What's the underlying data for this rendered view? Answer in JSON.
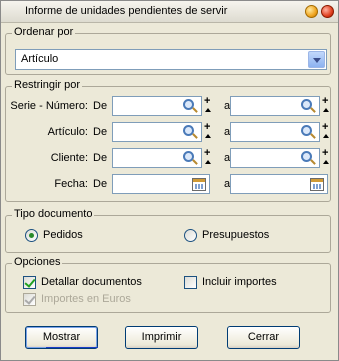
{
  "window": {
    "title": "Informe de unidades pendientes de servir"
  },
  "ordenar": {
    "legend": "Ordenar por",
    "selected": "Artículo"
  },
  "restringir": {
    "legend": "Restringir por",
    "de_label": "De",
    "a_label": "a",
    "rows": [
      {
        "label": "Serie - Número:",
        "type": "search"
      },
      {
        "label": "Artículo:",
        "type": "search"
      },
      {
        "label": "Cliente:",
        "type": "search"
      },
      {
        "label": "Fecha:",
        "type": "date"
      }
    ]
  },
  "tipo": {
    "legend": "Tipo documento",
    "pedidos": "Pedidos",
    "presupuestos": "Presupuestos",
    "selected": "Pedidos"
  },
  "opciones": {
    "legend": "Opciones",
    "detallar": "Detallar documentos",
    "detallar_checked": true,
    "euros": "Importes en Euros",
    "euros_checked": true,
    "euros_enabled": false,
    "importes": "Incluir importes",
    "importes_checked": false
  },
  "buttons": {
    "mostrar": "Mostrar",
    "imprimir": "Imprimir",
    "cerrar": "Cerrar"
  }
}
